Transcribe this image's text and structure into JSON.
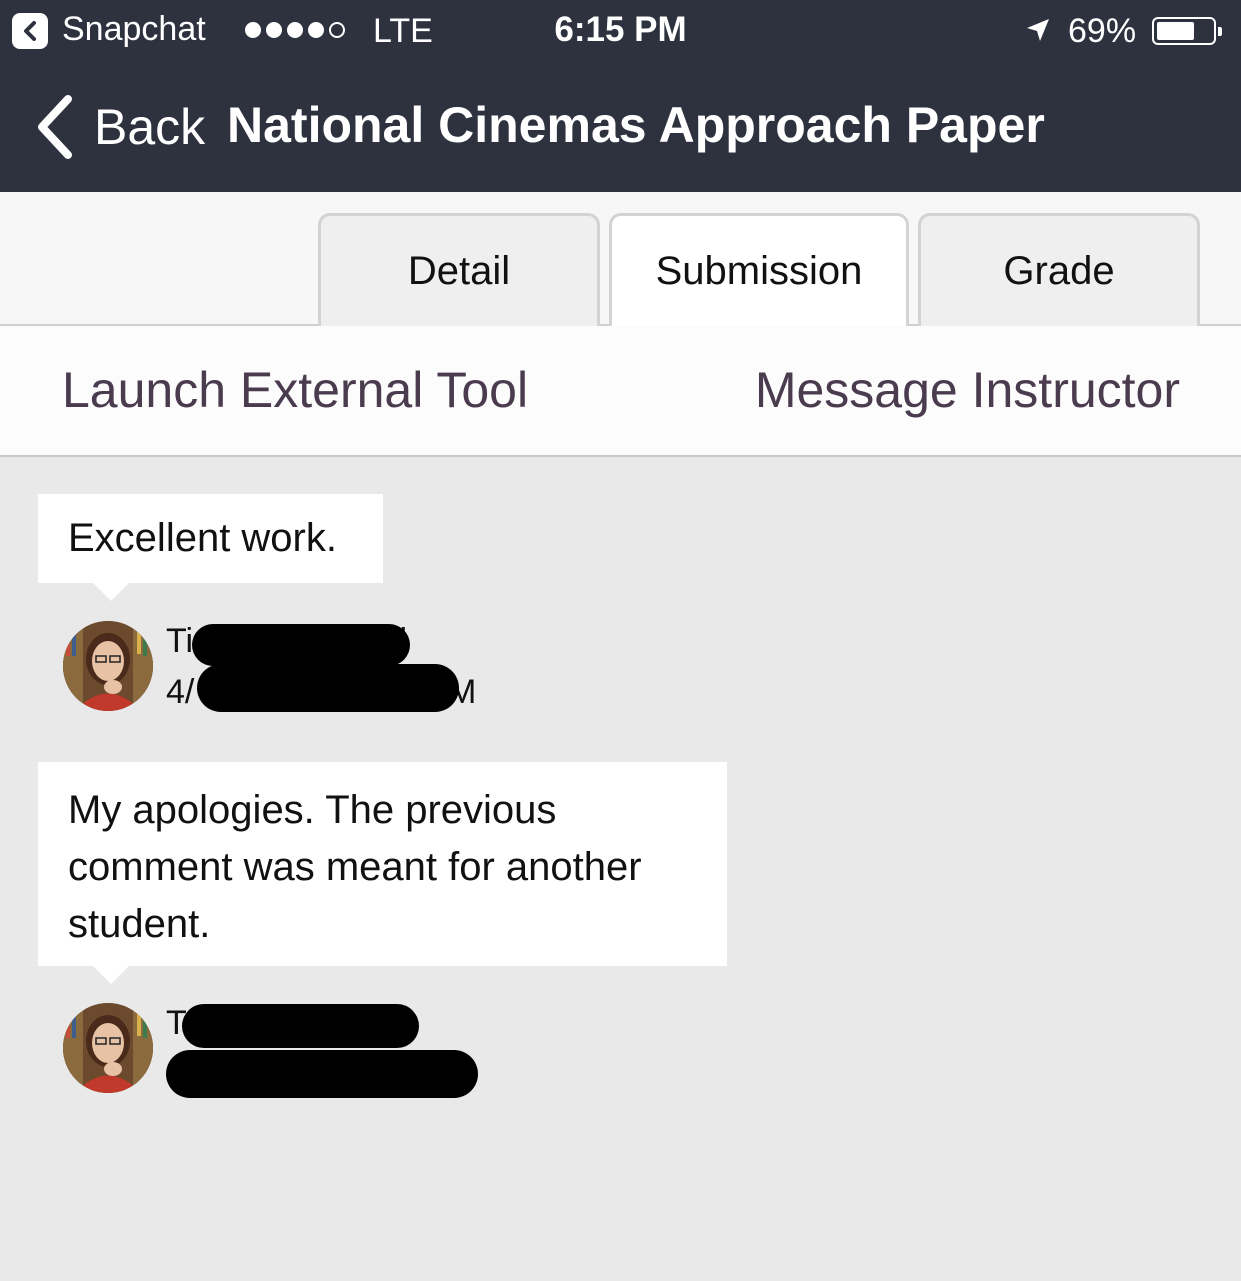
{
  "status_bar": {
    "back_app_label": "Snapchat",
    "signal_bars": 4,
    "signal_total": 5,
    "network": "LTE",
    "time": "6:15 PM",
    "battery_percent": "69%",
    "battery_level": 0.69
  },
  "nav": {
    "back_label": "Back",
    "title": "National Cinemas Approach Paper"
  },
  "tabs": [
    {
      "label": "Detail",
      "active": false
    },
    {
      "label": "Submission",
      "active": true
    },
    {
      "label": "Grade",
      "active": false
    }
  ],
  "actions": {
    "launch_tool": "Launch External Tool",
    "message_instructor": "Message Instructor"
  },
  "comments": [
    {
      "text": "Excellent work.",
      "author_visible": "Ti",
      "author_tail_visible": "ll",
      "date_visible": "4/",
      "date_tail_visible": "M"
    },
    {
      "text": "My apologies. The previous comment was meant for another student.",
      "author_visible": "T",
      "date_visible": ""
    }
  ],
  "colors": {
    "topbar": "#2d323e",
    "action_text": "#4a3b4e",
    "content_bg": "#e9e9e9"
  }
}
